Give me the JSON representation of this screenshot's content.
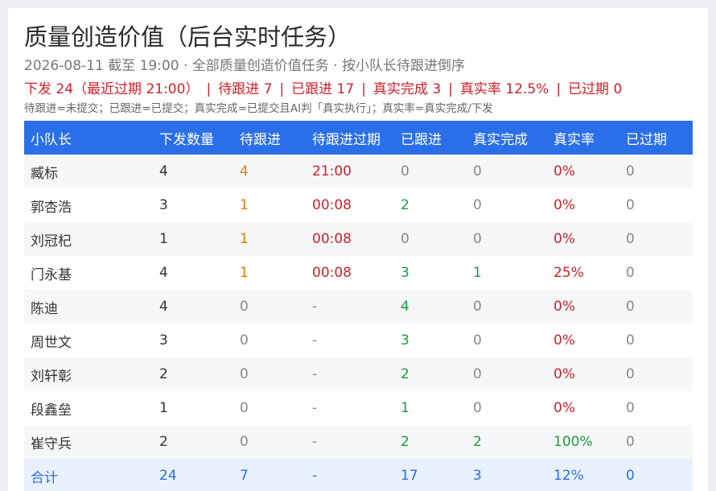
{
  "title": "质量创造价值（后台实时任务）",
  "subtitle": "2026-08-11 截至 19:00 · 全部质量创造价值任务 · 按小队长待跟进倒序",
  "summary": {
    "issued": "下发 24（最近过期 21:00）",
    "pending": "待跟进 7",
    "followed": "已跟进 17",
    "completed": "真实完成 3",
    "rate": "真实率 12.5%",
    "expired": "已过期 0",
    "separator": "|"
  },
  "note": "待跟进=未提交；已跟进=已提交；真实完成=已提交且AI判「真实执行」；真实率=真实完成/下发",
  "table": {
    "headers": [
      "小队长",
      "下发数量",
      "待跟进",
      "待跟进过期",
      "已跟进",
      "真实完成",
      "真实率",
      "已过期"
    ],
    "rows": [
      [
        "臧标",
        "4",
        "4",
        "21:00",
        "0",
        "0",
        "0%",
        "0"
      ],
      [
        "郭杏浩",
        "3",
        "1",
        "00:08",
        "2",
        "0",
        "0%",
        "0"
      ],
      [
        "刘冠杞",
        "1",
        "1",
        "00:08",
        "0",
        "0",
        "0%",
        "0"
      ],
      [
        "门永基",
        "4",
        "1",
        "00:08",
        "3",
        "1",
        "25%",
        "0"
      ],
      [
        "陈迪",
        "4",
        "0",
        "-",
        "4",
        "0",
        "0%",
        "0"
      ],
      [
        "周世文",
        "3",
        "0",
        "-",
        "3",
        "0",
        "0%",
        "0"
      ],
      [
        "刘轩彰",
        "2",
        "0",
        "-",
        "2",
        "0",
        "0%",
        "0"
      ],
      [
        "段鑫垒",
        "1",
        "0",
        "-",
        "1",
        "0",
        "0%",
        "0"
      ],
      [
        "崔守兵",
        "2",
        "0",
        "-",
        "2",
        "2",
        "100%",
        "0"
      ]
    ],
    "total": [
      "合计",
      "24",
      "7",
      "-",
      "17",
      "3",
      "12%",
      "0"
    ]
  },
  "colors": {
    "header_bg": "#2b6fe8",
    "alert_red": "#d0202a",
    "pending_orange": "#e07b00",
    "success_green": "#1f9a3c",
    "total_bg": "#e8f1fd"
  }
}
